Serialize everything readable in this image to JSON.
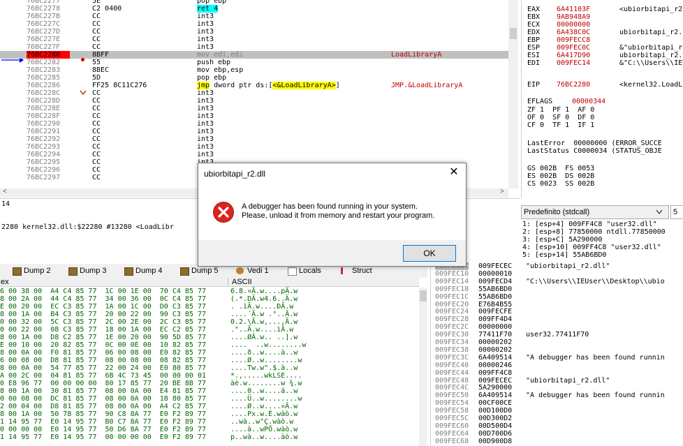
{
  "colors": {
    "accent_red": "#c00000",
    "highlight_cyan": "#00ffff",
    "highlight_yellow": "#ffff00",
    "current_row": "#c0c0c0",
    "eip_marker": "#ff0000"
  },
  "disasm": {
    "rows": [
      {
        "addr": "76BC2277",
        "bytes": "5E",
        "instr": "pop ebp",
        "cmt": ""
      },
      {
        "addr": "76BC2278",
        "bytes": "C2 0400",
        "instr": "ret 4",
        "cmt": ""
      },
      {
        "addr": "76BC227B",
        "bytes": "CC",
        "instr": "int3",
        "cmt": ""
      },
      {
        "addr": "76BC227C",
        "bytes": "CC",
        "instr": "int3",
        "cmt": ""
      },
      {
        "addr": "76BC227D",
        "bytes": "CC",
        "instr": "int3",
        "cmt": ""
      },
      {
        "addr": "76BC227E",
        "bytes": "CC",
        "instr": "int3",
        "cmt": ""
      },
      {
        "addr": "76BC227F",
        "bytes": "CC",
        "instr": "int3",
        "cmt": ""
      },
      {
        "addr": "76BC2280",
        "bytes": "8BFF",
        "instr": "mov edi,edi",
        "cmt": "LoadLibraryA"
      },
      {
        "addr": "76BC2282",
        "bytes": "55",
        "instr": "push ebp",
        "cmt": ""
      },
      {
        "addr": "76BC2283",
        "bytes": "8BEC",
        "instr": "mov ebp,esp",
        "cmt": ""
      },
      {
        "addr": "76BC2285",
        "bytes": "5D",
        "instr": "pop ebp",
        "cmt": ""
      },
      {
        "addr": "76BC2286",
        "bytes": "FF25 8C11C276",
        "instr": "jmp dword ptr ds:[<&LoadLibraryA>]",
        "cmt": "JMP.&LoadLibraryA"
      },
      {
        "addr": "76BC228C",
        "bytes": "CC",
        "instr": "int3",
        "cmt": ""
      },
      {
        "addr": "76BC228D",
        "bytes": "CC",
        "instr": "int3",
        "cmt": ""
      },
      {
        "addr": "76BC228E",
        "bytes": "CC",
        "instr": "int3",
        "cmt": ""
      },
      {
        "addr": "76BC228F",
        "bytes": "CC",
        "instr": "int3",
        "cmt": ""
      },
      {
        "addr": "76BC2290",
        "bytes": "CC",
        "instr": "int3",
        "cmt": ""
      },
      {
        "addr": "76BC2291",
        "bytes": "CC",
        "instr": "int3",
        "cmt": ""
      },
      {
        "addr": "76BC2292",
        "bytes": "CC",
        "instr": "int3",
        "cmt": ""
      },
      {
        "addr": "76BC2293",
        "bytes": "CC",
        "instr": "int3",
        "cmt": ""
      },
      {
        "addr": "76BC2294",
        "bytes": "CC",
        "instr": "int3",
        "cmt": ""
      },
      {
        "addr": "76BC2295",
        "bytes": "CC",
        "instr": "int3",
        "cmt": ""
      },
      {
        "addr": "76BC2296",
        "bytes": "CC",
        "instr": "int3",
        "cmt": ""
      },
      {
        "addr": "76BC2297",
        "bytes": "CC",
        "instr": "int3",
        "cmt": ""
      }
    ]
  },
  "registers": {
    "rows": [
      {
        "n": "EAX",
        "v": "6A41103F",
        "c": "<ubiorbitapi_r2."
      },
      {
        "n": "EBX",
        "v": "9AB948A9",
        "c": ""
      },
      {
        "n": "ECX",
        "v": "00000000",
        "c": ""
      },
      {
        "n": "EDX",
        "v": "6A438C0C",
        "c": "ubiorbitapi_r2."
      },
      {
        "n": "EBP",
        "v": "009FECC8",
        "c": ""
      },
      {
        "n": "ESP",
        "v": "009FEC0C",
        "c": "&\"ubiorbitapi_r2"
      },
      {
        "n": "ESI",
        "v": "6A417D90",
        "c": "ubiorbitapi_r2."
      },
      {
        "n": "EDI",
        "v": "009FEC14",
        "c": "&\"C:\\\\Users\\\\IEUs"
      }
    ],
    "eip": {
      "n": "EIP",
      "v": "76BC2280",
      "c": "<kernel32.LoadL"
    },
    "eflags": {
      "n": "EFLAGS",
      "v": "00000344"
    },
    "flags": [
      "ZF 1  PF 1  AF 0",
      "OF 0  SF 0  DF 0",
      "CF 0  TF 1  IF 1"
    ],
    "last_error": "LastError  00000000 (ERROR_SUCCE",
    "last_status": "LastStatus C0000034 (STATUS_OBJE",
    "segs": [
      "GS 002B  FS 0053",
      "ES 002B  DS 002B",
      "CS 0023  SS 002B"
    ]
  },
  "info": {
    "line1": "14",
    "line2": "2280 kernel32.dll:$22280 #13280 <LoadLibr"
  },
  "callconv": {
    "label": "Predefinito (stdcall)",
    "count": "5",
    "rows": [
      "1: [esp+4] 009FF4C8 \"user32.dll\"",
      "2: [esp+8] 77850000 ntdll.77850000",
      "3: [esp+C] 5A290000",
      "4: [esp+10] 009FF4C8 \"user32.dll\"",
      "5: [esp+14] 55AB6BD0"
    ]
  },
  "tabs": [
    "Dump 2",
    "Dump 3",
    "Dump 4",
    "Dump 5",
    "Vedi 1",
    "Locals",
    "Struct"
  ],
  "dump": {
    "hex_header": "ex",
    "ascii_header": "ASCII",
    "rows": [
      {
        "h": "6 00 38 00  A4 C4 85 77  1C 00 1E 00  70 C4 85 77",
        "a": "6.8.¤Ä.w....pÄ.w"
      },
      {
        "h": "8 00 2A 00  44 C4 85 77  34 00 36 00  0C C4 85 77",
        "a": "(.*.DÄ.w4.6..Ä.w"
      },
      {
        "h": "E 00 20 00  EC C3 85 77  1A 00 1C 00  D0 C3 85 77",
        "a": ". .ìÃ.w....ÐÃ.w"
      },
      {
        "h": "8 00 1A 00  B4 C3 85 77  20 00 22 00  90 C3 85 77",
        "a": "....´Ã.w .\"..Ã.w"
      },
      {
        "h": "0 00 32 00  5C C3 85 77  2C 00 2E 00  2C C3 85 77",
        "a": "0.2.\\Ã.w,...,Ã.w"
      },
      {
        "h": "0 00 22 00  08 C3 85 77  18 00 1A 00  EC C2 85 77",
        "a": ".\"..Ã.w....ìÂ.w"
      },
      {
        "h": "8 00 1A 00  D8 C2 85 77  1E 00 20 00  90 5D 85 77",
        "a": "....ØÂ.w.. ..].w"
      },
      {
        "h": "E 00 10 00  20 82 85 77  0C 00 0E 00  10 82 85 77",
        "a": "....  ..w........w"
      },
      {
        "h": "8 00 0A 00  F0 81 85 77  06 00 08 00  E0 82 85 77",
        "a": "....ð..w....à..w"
      },
      {
        "h": "6 00 08 00  D8 81 85 77  08 00 08 00  08 82 85 77",
        "a": "....Ø..w........w"
      },
      {
        "h": "8 00 0A 00  54 77 85 77  22 00 24 00  E0 80 85 77",
        "a": "....Tw.w\".$.à..w"
      },
      {
        "h": "A 00 2C 00  04 81 85 77  6B 4C 73 45  00 00 00 01",
        "a": "*.,.....wkLSE...."
      },
      {
        "h": "0 E8 96 77  00 00 00 00  80 17 85 77  20 BE 8B 77",
        "a": "àè.w........w ¾.w"
      },
      {
        "h": "8 00 1A 00  30 81 85 77  08 00 0A 00  E4 81 85 77",
        "a": "....0..w....ä..w"
      },
      {
        "h": "0 00 08 00  DC 81 85 77  08 00 0A 00  18 80 85 77",
        "a": "....Ü..w........w"
      },
      {
        "h": "2 00 04 00  D8 81 85 77  08 00 0A 00  A4 C2 85 77",
        "a": "....Ø..w....¤Â.w"
      },
      {
        "h": "8 00 1A 00  50 78 85 77  90 C8 8A 77  E0 F2 89 77",
        "a": "....Px.w.È.wàò.w"
      },
      {
        "h": "1 14 95 77  E0 14 95 77  B0 C7 8A 77  E0 F2 89 77",
        "a": "..wà..w°Ç.wàò.w"
      },
      {
        "h": "0 00 00 00  E0 14 95 77  50 D6 8A 77  E0 F2 89 77",
        "a": "....à..wPÖ.wàò.w"
      },
      {
        "h": "1 14 95 77  E0 14 95 77  00 00 00 00  E0 F2 89 77",
        "a": "p..wà..w....àò.w"
      }
    ]
  },
  "stack": {
    "rows": [
      {
        "a": "009FEC0C",
        "v": "009FECEC",
        "c": "\"ubiorbitapi_r2.dll\""
      },
      {
        "a": "009FEC10",
        "v": "00000010",
        "c": ""
      },
      {
        "a": "009FEC14",
        "v": "009FECD4",
        "c": "\"C:\\\\Users\\\\IEUser\\\\Desktop\\\\ubio"
      },
      {
        "a": "009FEC18",
        "v": "55AB6BD0",
        "c": ""
      },
      {
        "a": "009FEC1C",
        "v": "55AB6BD0",
        "c": ""
      },
      {
        "a": "009FEC20",
        "v": "E76B4B55",
        "c": ""
      },
      {
        "a": "009FEC24",
        "v": "009FECFE",
        "c": ""
      },
      {
        "a": "009FEC28",
        "v": "009FF4D4",
        "c": ""
      },
      {
        "a": "009FEC2C",
        "v": "00000000",
        "c": ""
      },
      {
        "a": "009FEC30",
        "v": "77411F70",
        "c": "user32.77411F70"
      },
      {
        "a": "009FEC34",
        "v": "00000202",
        "c": ""
      },
      {
        "a": "009FEC38",
        "v": "00000202",
        "c": ""
      },
      {
        "a": "009FEC3C",
        "v": "6A409514",
        "c": "\"A debugger has been found runnin"
      },
      {
        "a": "009FEC40",
        "v": "00000246",
        "c": ""
      },
      {
        "a": "009FEC44",
        "v": "009FF4C8",
        "c": ""
      },
      {
        "a": "009FEC48",
        "v": "009FECEC",
        "c": "\"ubiorbitapi_r2.dll\""
      },
      {
        "a": "009FEC4C",
        "v": "5A290000",
        "c": ""
      },
      {
        "a": "009FEC50",
        "v": "6A409514",
        "c": "\"A debugger has been found runnin"
      },
      {
        "a": "009FEC54",
        "v": "00CF00CE",
        "c": ""
      },
      {
        "a": "009FEC58",
        "v": "00D100D0",
        "c": ""
      },
      {
        "a": "009FEC5C",
        "v": "00D300D2",
        "c": ""
      },
      {
        "a": "009FEC60",
        "v": "00D500D4",
        "c": ""
      },
      {
        "a": "009FEC64",
        "v": "00D700D6",
        "c": ""
      },
      {
        "a": "009FEC68",
        "v": "00D900D8",
        "c": ""
      }
    ]
  },
  "dialog": {
    "title": "ubiorbitapi_r2.dll",
    "close_label": "✕",
    "message_line1": "A debugger has been found running in your system.",
    "message_line2": "Please, unload it from memory and restart your program.",
    "ok_label": "OK",
    "icon": "error-icon"
  }
}
